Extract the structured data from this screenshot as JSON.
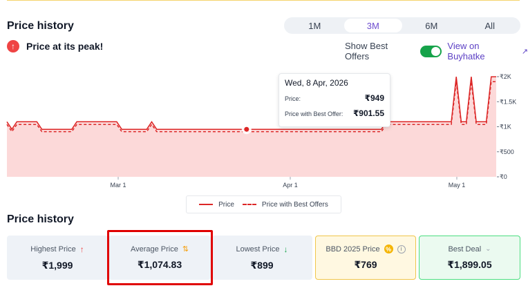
{
  "header": {
    "title": "Price history"
  },
  "ranges": [
    {
      "label": "1M",
      "active": false
    },
    {
      "label": "3M",
      "active": true
    },
    {
      "label": "6M",
      "active": false
    },
    {
      "label": "All",
      "active": false
    }
  ],
  "peak_message": "Price at its peak!",
  "offers": {
    "label": "Show Best Offers",
    "enabled": true,
    "link": "View on Buyhatke"
  },
  "chart_data": {
    "type": "line",
    "x_ticks": [
      "Mar 1",
      "Apr 1",
      "May 1"
    ],
    "y_ticks": [
      "₹0",
      "₹500",
      "₹1K",
      "₹1.5K",
      "₹2K"
    ],
    "ylim": [
      0,
      2000
    ],
    "series": [
      {
        "name": "Price",
        "style": "solid",
        "color": "#dc2626",
        "values": [
          1100,
          950,
          1100,
          1100,
          1100,
          1100,
          1100,
          949,
          949,
          949,
          949,
          949,
          949,
          949,
          1100,
          1100,
          1100,
          1100,
          1100,
          1100,
          1100,
          1100,
          1100,
          949,
          949,
          949,
          949,
          949,
          949,
          1100,
          949,
          949,
          949,
          949,
          949,
          949,
          949,
          949,
          949,
          949,
          949,
          949,
          949,
          949,
          949,
          949,
          949,
          949,
          949,
          949,
          949,
          949,
          949,
          949,
          949,
          949,
          949,
          949,
          949,
          949,
          949,
          949,
          949,
          949,
          949,
          949,
          949,
          949,
          949,
          949,
          949,
          949,
          949,
          949,
          949,
          949,
          1100,
          1100,
          1100,
          1100,
          1100,
          1100,
          1100,
          1100,
          1100,
          1100,
          1100,
          1100,
          1100,
          1100,
          1999,
          1100,
          1100,
          1999,
          1100,
          1100,
          1100,
          1999,
          1999
        ]
      },
      {
        "name": "Price with Best Offers",
        "style": "dashed",
        "color": "#dc2626",
        "values": [
          1045,
          902,
          1045,
          1045,
          1045,
          1045,
          1045,
          902,
          902,
          902,
          902,
          902,
          902,
          902,
          1045,
          1045,
          1045,
          1045,
          1045,
          1045,
          1045,
          1045,
          1045,
          902,
          902,
          902,
          902,
          902,
          902,
          1045,
          902,
          902,
          902,
          902,
          902,
          902,
          902,
          902,
          902,
          902,
          902,
          902,
          902,
          902,
          902,
          902,
          902,
          902,
          902,
          902,
          902,
          902,
          902,
          902,
          902,
          902,
          902,
          902,
          902,
          902,
          902,
          902,
          902,
          902,
          902,
          902,
          902,
          902,
          902,
          902,
          902,
          902,
          902,
          902,
          902,
          902,
          1045,
          1045,
          1045,
          1045,
          1045,
          1045,
          1045,
          1045,
          1045,
          1045,
          1045,
          1045,
          1045,
          1045,
          1899,
          1045,
          1045,
          1899,
          1045,
          1045,
          1045,
          1899,
          1899
        ]
      }
    ],
    "highlight_index": 48
  },
  "tooltip": {
    "date": "Wed, 8 Apr, 2026",
    "price_label": "Price:",
    "price_value": "₹949",
    "offer_label": "Price with Best Offer:",
    "offer_value": "₹901.55"
  },
  "legend": {
    "price": "Price",
    "offer": "Price with Best Offers"
  },
  "section2": {
    "title": "Price history"
  },
  "stats": {
    "highest": {
      "label": "Highest Price",
      "value": "₹1,999"
    },
    "average": {
      "label": "Average Price",
      "value": "₹1,074.83"
    },
    "lowest": {
      "label": "Lowest Price",
      "value": "₹899"
    },
    "bbd": {
      "label": "BBD 2025 Price",
      "value": "₹769"
    },
    "deal": {
      "label": "Best Deal",
      "value": "₹1,899.05"
    }
  },
  "colors": {
    "accent": "#6d4ccf",
    "toggle": "#16a34a",
    "line": "#dc2626",
    "area": "#fcd9d9",
    "highlight_box": "#e00000"
  }
}
